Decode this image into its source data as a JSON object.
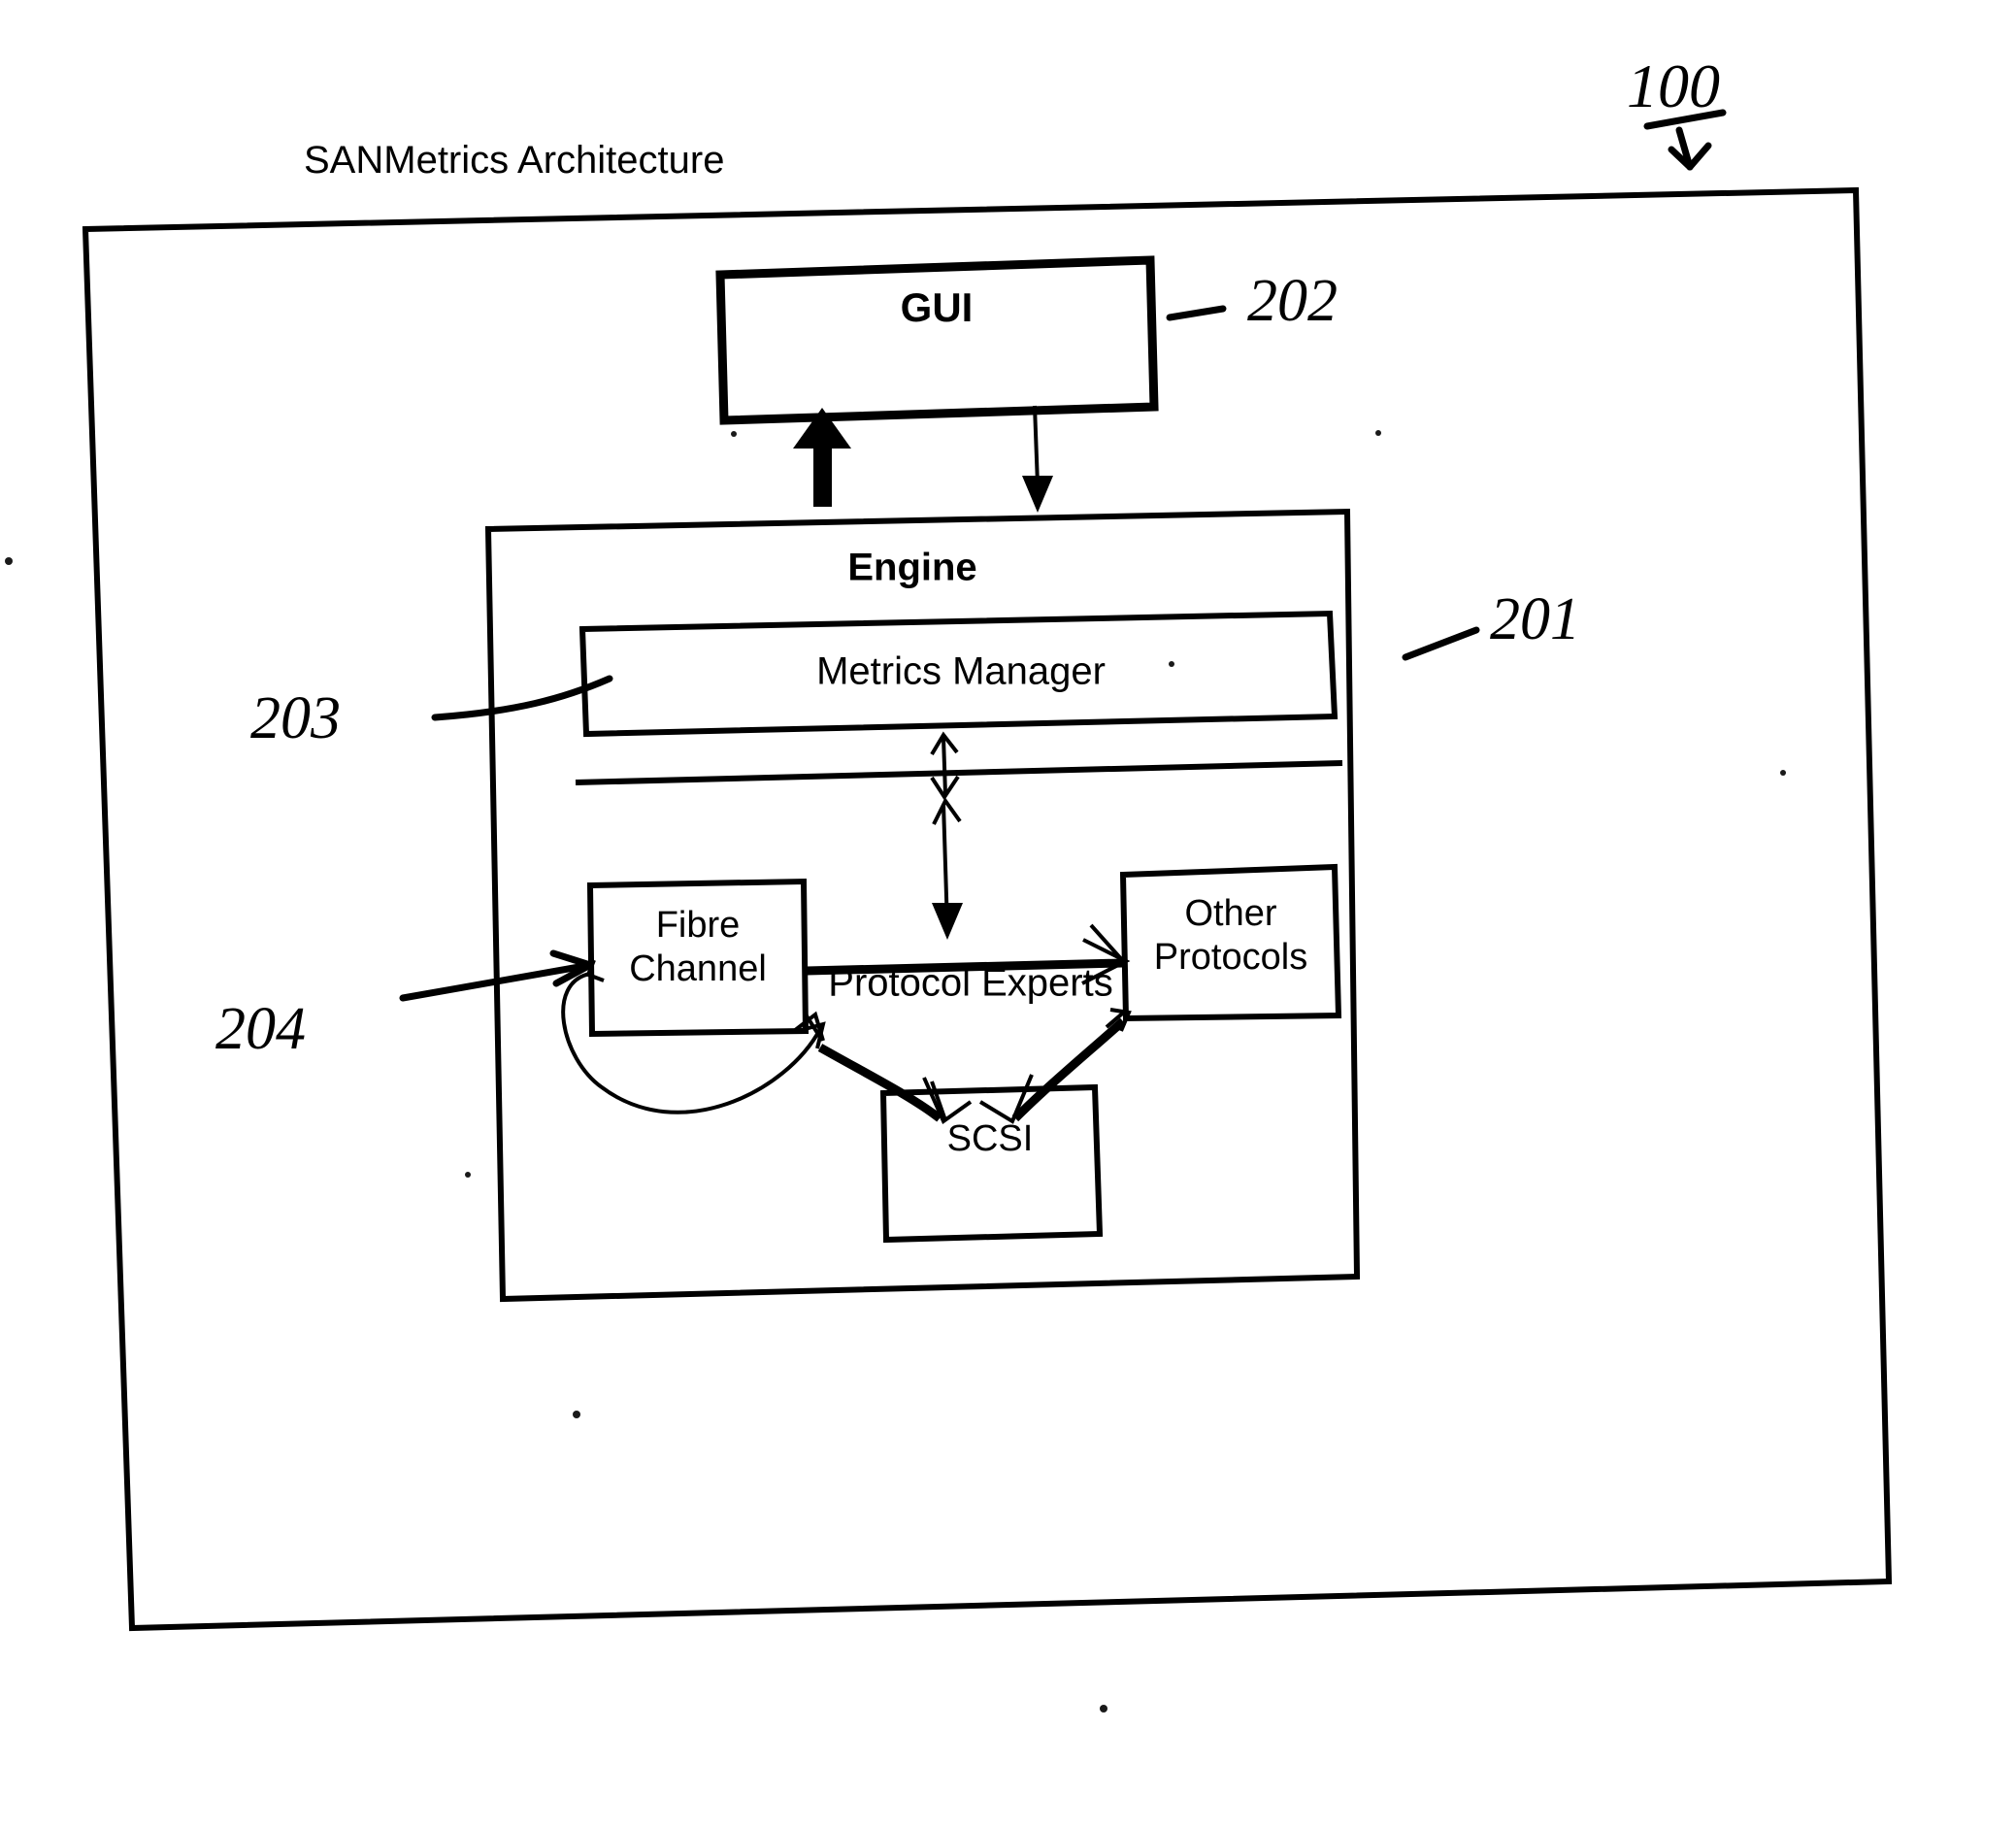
{
  "figure": {
    "title": "SANMetrics Architecture",
    "figure_number": "100",
    "ink_color": "#000000",
    "background_color": "#ffffff"
  },
  "boxes": {
    "gui": {
      "label": "GUI",
      "ref": "202"
    },
    "engine": {
      "label": "Engine",
      "ref": "201"
    },
    "metrics_manager": {
      "label": "Metrics Manager",
      "ref": "203"
    },
    "fibre_channel": {
      "label_line1": "Fibre",
      "label_line2": "Channel",
      "ref": "204"
    },
    "other_protocols": {
      "label_line1": "Other",
      "label_line2": "Protocols"
    },
    "scsi": {
      "label": "SCSI"
    }
  },
  "labels": {
    "protocol_experts": "Protocol Experts"
  },
  "reference_numerals": {
    "figure": "100",
    "engine": "201",
    "gui": "202",
    "metrics_manager": "203",
    "protocol_expert_layer": "204"
  }
}
